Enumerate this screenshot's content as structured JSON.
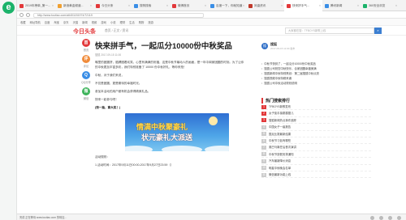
{
  "browser": {
    "logo_letter": "e",
    "tabs": [
      {
        "label": "2019年榜单_第一..."
      },
      {
        "label": "新浪黄金频道..."
      },
      {
        "label": "今日头条"
      },
      {
        "label": "搜狗搜索"
      },
      {
        "label": "微博首页"
      },
      {
        "label": "百度一下，你就知道"
      },
      {
        "label": "凤凰资讯"
      },
      {
        "label": "快来拼手气..."
      },
      {
        "label": "腾讯新闻"
      },
      {
        "label": "360安全浏览"
      }
    ],
    "address": "http://www.toutiao.com/a6401151974/72119",
    "bookmarks": [
      "收藏",
      "网址导航",
      "百度",
      "淘宝",
      "京东",
      "天猫",
      "新闻",
      "视频",
      "游戏",
      "小说",
      "理财",
      "生活",
      "购物",
      "旅游"
    ],
    "status_text": "完成 正在等待 www.toutiao.com 的响应..."
  },
  "site": {
    "logo": "今日头条",
    "breadcrumb": "首页 / 正文 / 资讯",
    "search_placeholder": "大家都在搜：TFBOYS新歌上线",
    "search_icon": "search-icon"
  },
  "nav": [
    {
      "icon": "home-icon",
      "glyph": "首",
      "label": "首页",
      "color": "#e2383a"
    },
    {
      "icon": "chat-icon",
      "glyph": "评",
      "label": "评论",
      "color": "#f08b3a"
    },
    {
      "icon": "share-icon",
      "glyph": "Q",
      "label": "QQ分享",
      "color": "#3a8ee6"
    },
    {
      "icon": "wechat-icon",
      "glyph": "微",
      "label": "微信",
      "color": "#3db35a"
    }
  ],
  "article": {
    "title": "快来拼手气，一起瓜分10000份中秋奖品",
    "meta": "搜狐 2017-09-15 11:00",
    "paragraphs": [
      "嘴里的团圆饼，胳膊圈着欢笑，心里有满满的祝福，这是中秋节最动人的画面，是一年中阖家团圆的时刻。为了让你的中秋更加丰富多彩，我们特别准备了 10000 份中秋好礼，等你来抢！",
      "中秋，对于我们来说，",
      "不仅是团圆，更是期待的幸福时光。",
      "参加本活动的用户都有机会获得精美礼品。",
      "快来一起参与吧！"
    ],
    "bold_line": "(快一抽，拿大奖！)",
    "banner_line1": "情满中秋聚豪礼",
    "banner_line2": "状元豪礼大派送",
    "footer1": "活动规则：",
    "footer2": "1.活动时间：2017年9月11日00:00-2017年9月27日23:59（）"
  },
  "right": {
    "author_name": "搜狐",
    "author_sub": "2017-09-15 11:00 发布",
    "related": [
      "中秋节快到了，一起瓜分10000份中秋奖品",
      "搜狐公司祝您中秋快乐，合家团圆幸福美满",
      "搜狐新闻中秋特别策划：第二届搜狐中秋点亮",
      "搜狐视频中秋特辑来袭",
      "搜狐公司中秋活动规则说明"
    ],
    "hot_title": "热门搜索排行",
    "hot_list": [
      "TFBOYS新歌发布",
      "女子徒手接跳楼婴儿",
      "搜狐新闻热点事件追踪",
      "中国女子一级报告",
      "国足比赛最新结果",
      "中秋节习俗有哪些",
      "奥巴马离任后首次演讲",
      "中秋节放假安排通知",
      "汽车最新降价消息",
      "明星中秋晚会名单",
      "微信最新功能上线"
    ]
  }
}
